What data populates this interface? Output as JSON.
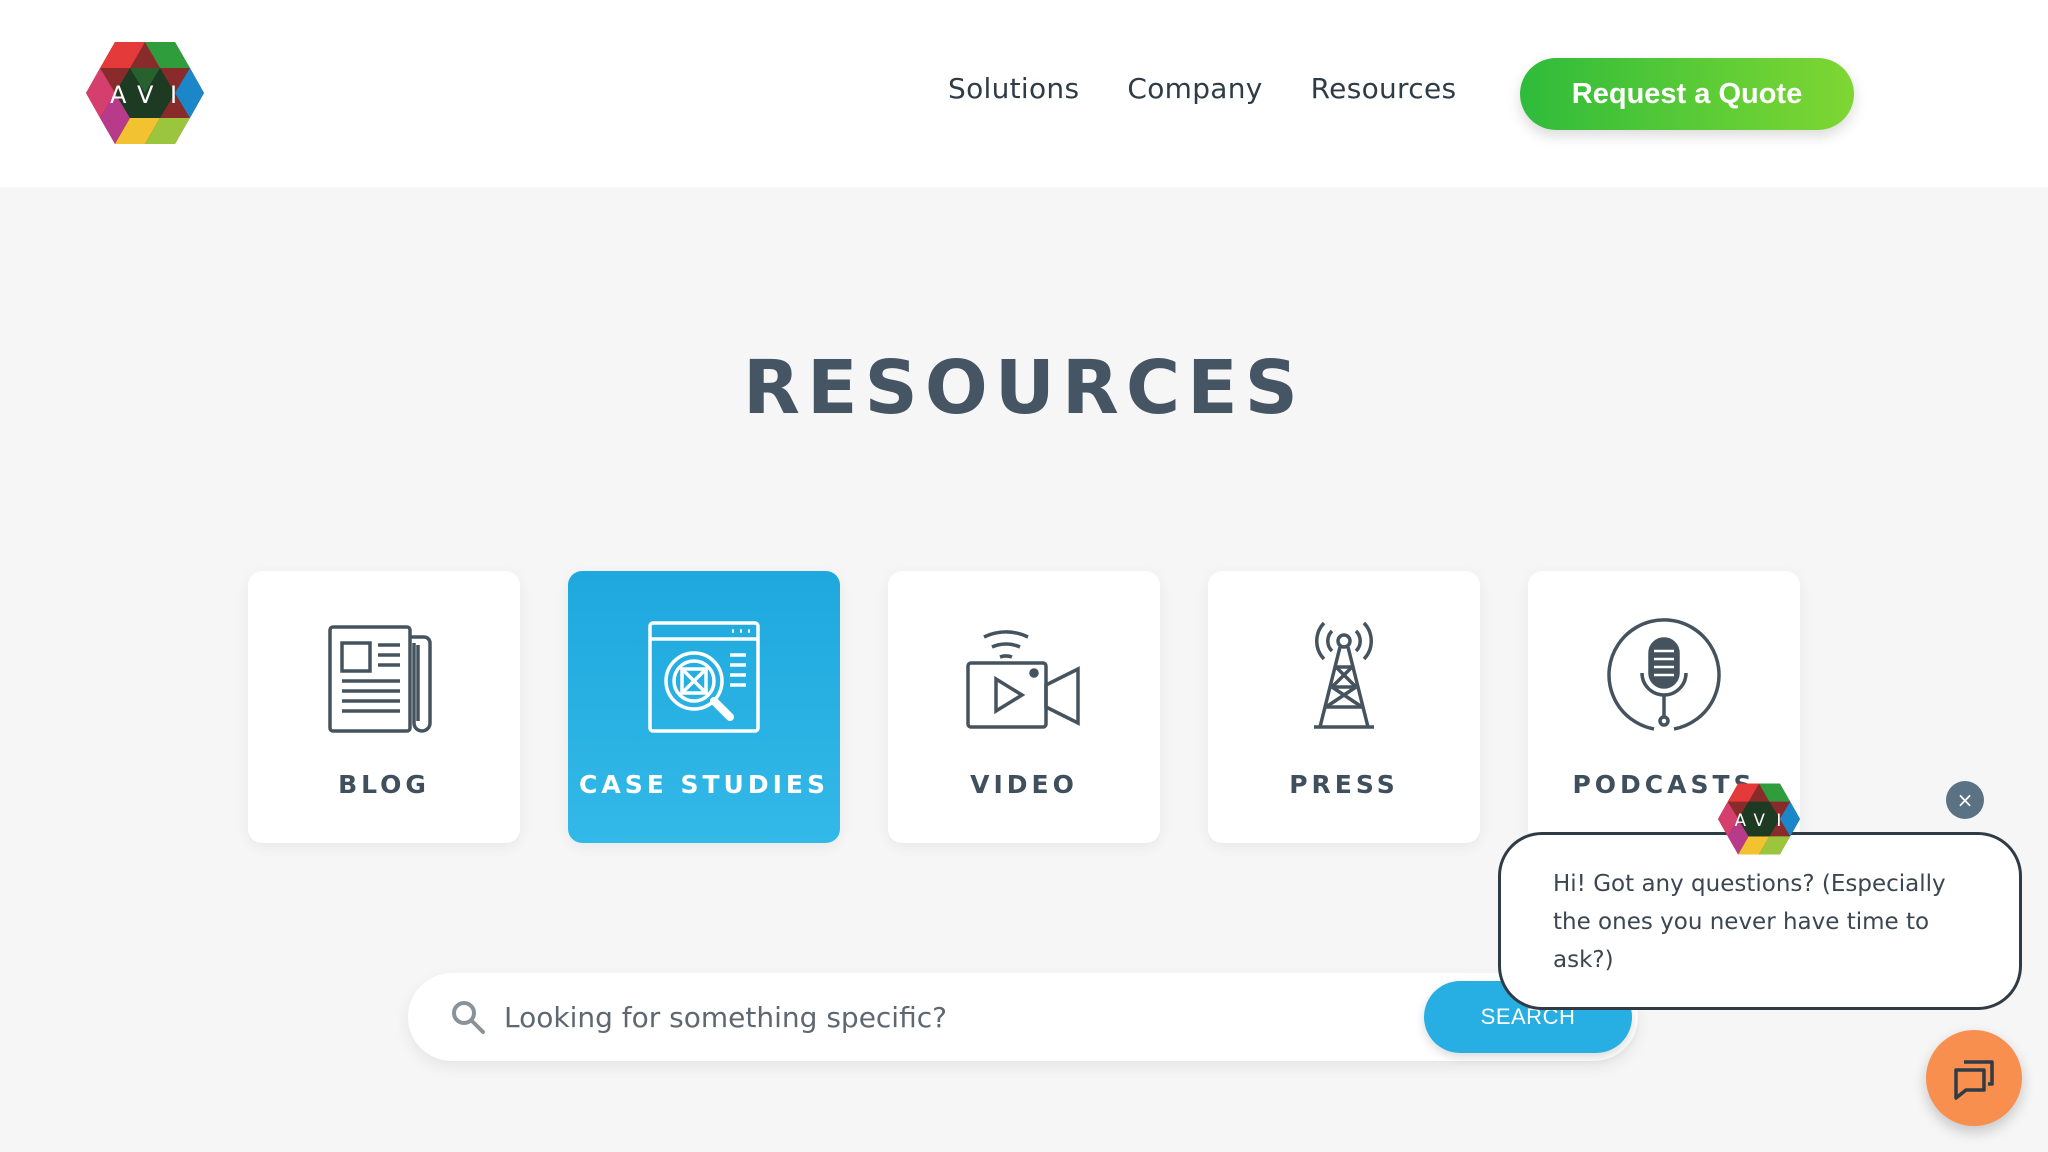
{
  "header": {
    "logo_letters": [
      "A",
      "V",
      "I"
    ],
    "nav": [
      {
        "label": "Solutions"
      },
      {
        "label": "Company"
      },
      {
        "label": "Resources"
      }
    ],
    "cta_label": "Request a Quote"
  },
  "main": {
    "title": "RESOURCES",
    "tiles": [
      {
        "label": "BLOG",
        "icon": "newspaper-icon",
        "active": false
      },
      {
        "label": "CASE STUDIES",
        "icon": "case-study-icon",
        "active": true
      },
      {
        "label": "VIDEO",
        "icon": "video-camera-icon",
        "active": false
      },
      {
        "label": "PRESS",
        "icon": "radio-tower-icon",
        "active": false
      },
      {
        "label": "PODCASTS",
        "icon": "microphone-icon",
        "active": false
      }
    ],
    "search": {
      "placeholder": "Looking for something specific?",
      "button_label": "SEARCH"
    }
  },
  "chat": {
    "close_symbol": "×",
    "message": "Hi! Got any questions? (Especially the ones you never have time to ask?)"
  },
  "colors": {
    "accent_green": "#3cc43a",
    "accent_blue": "#27aee2",
    "chat_orange": "#f98f4e",
    "text_dark": "#455563"
  }
}
